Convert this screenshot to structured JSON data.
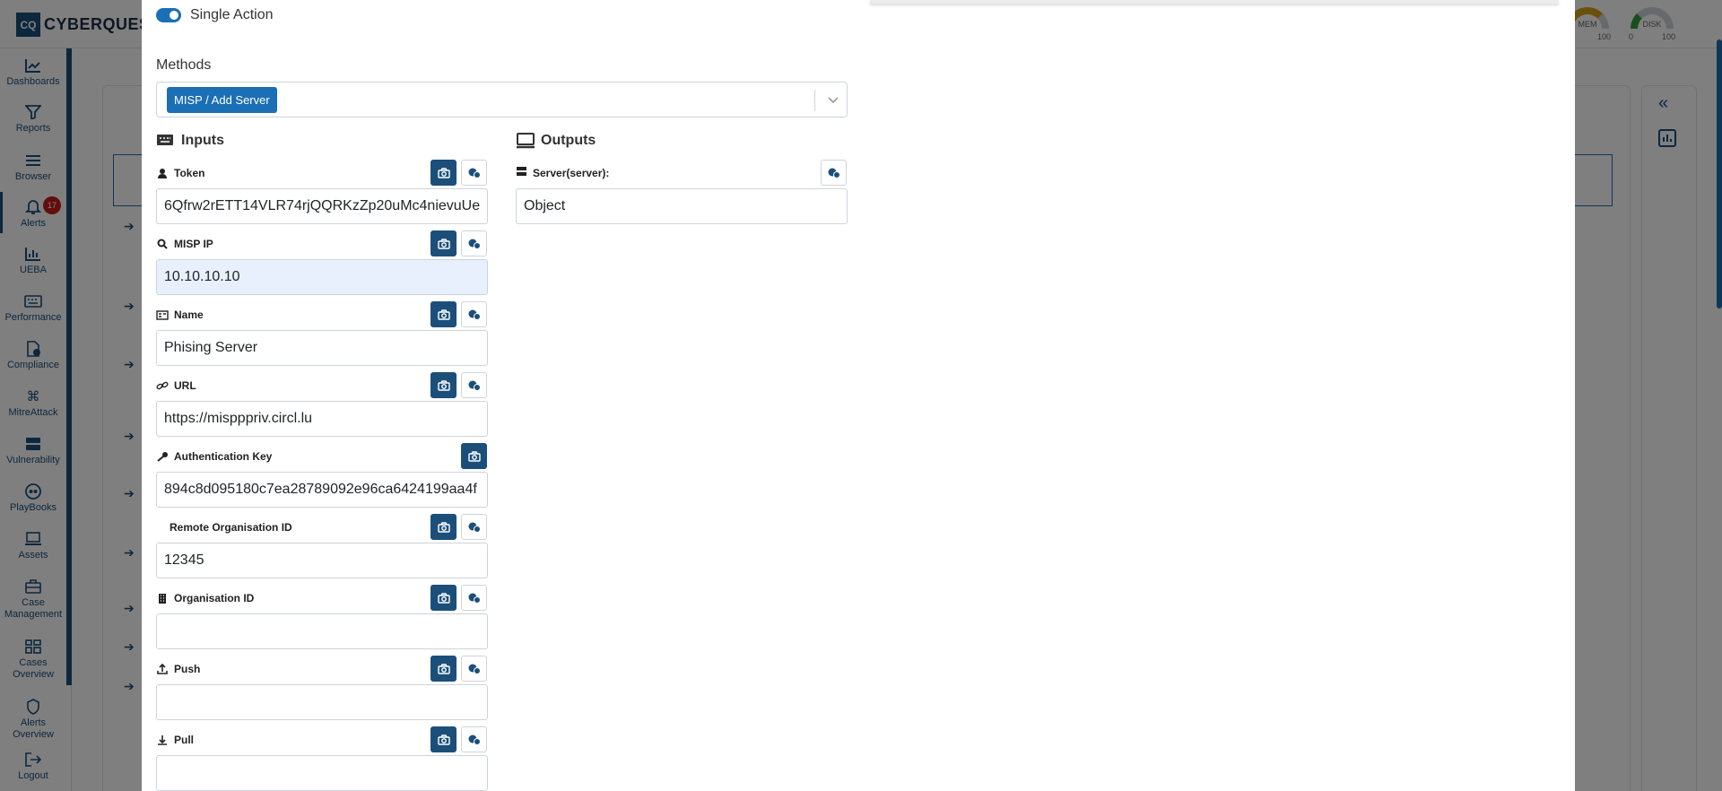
{
  "app": {
    "logo_mark": "CQ",
    "logo_text": "CYBERQUEST",
    "gauges": [
      {
        "label": "MEM",
        "min": "",
        "max": "100",
        "color": "#d4a017"
      },
      {
        "label": "DISK",
        "min": "0",
        "max": "100",
        "color": "#2e9e3a"
      }
    ]
  },
  "sidebar": {
    "items": [
      {
        "label": "Dashboards",
        "icon": "chart-line-icon"
      },
      {
        "label": "Reports",
        "icon": "filter-icon"
      },
      {
        "label": "Browser",
        "icon": "list-icon"
      },
      {
        "label": "Alerts",
        "icon": "bell-icon",
        "badge": "17"
      },
      {
        "label": "UEBA",
        "icon": "chart-bar-icon"
      },
      {
        "label": "Performance",
        "icon": "keyboard-icon"
      },
      {
        "label": "Compliance",
        "icon": "file-check-icon"
      },
      {
        "label": "MitreAttack",
        "icon": "command-icon"
      },
      {
        "label": "Vulnerability",
        "icon": "server-icon"
      },
      {
        "label": "PlayBooks",
        "icon": "playbook-icon"
      },
      {
        "label": "Assets",
        "icon": "laptop-icon"
      },
      {
        "label": "Case\nManagement",
        "icon": "briefcase-icon"
      },
      {
        "label": "Cases\nOverview",
        "icon": "grid-icon"
      },
      {
        "label": "Alerts\nOverview",
        "icon": "shield-icon"
      },
      {
        "label": "Logout",
        "icon": "logout-icon"
      }
    ]
  },
  "modal": {
    "toggle_label": "Single Action",
    "toggle_on": true,
    "methods_label": "Methods",
    "method_selected": "MISP / Add Server",
    "inputs_title": "Inputs",
    "outputs_title": "Outputs",
    "inputs": [
      {
        "label": "Token",
        "value": "6Qfrw2rETT14VLR74rjQQRKzZp20uMc4nievuUe",
        "icon": "user-secret-icon",
        "variable_button": true
      },
      {
        "label": "MISP IP",
        "value": "10.10.10.10",
        "icon": "search-icon",
        "variable_button": true
      },
      {
        "label": "Name",
        "value": "Phising Server",
        "icon": "id-card-icon",
        "variable_button": true
      },
      {
        "label": "URL",
        "value": "https://mispppriv.circl.lu",
        "icon": "link-icon",
        "variable_button": true
      },
      {
        "label": "Authentication Key",
        "value": "894c8d095180c7ea28789092e96ca6424199aa4f",
        "icon": "key-icon",
        "variable_button": false
      },
      {
        "label": "Remote Organisation ID",
        "value": "12345",
        "icon": "",
        "variable_button": true
      },
      {
        "label": "Organisation ID",
        "value": "",
        "icon": "building-icon",
        "variable_button": true
      },
      {
        "label": "Push",
        "value": "",
        "icon": "upload-icon",
        "variable_button": true
      },
      {
        "label": "Pull",
        "value": "",
        "icon": "download-icon",
        "variable_button": true
      }
    ],
    "outputs": [
      {
        "label": "Server(server):",
        "value": "Object",
        "icon": "server-icon"
      }
    ]
  }
}
